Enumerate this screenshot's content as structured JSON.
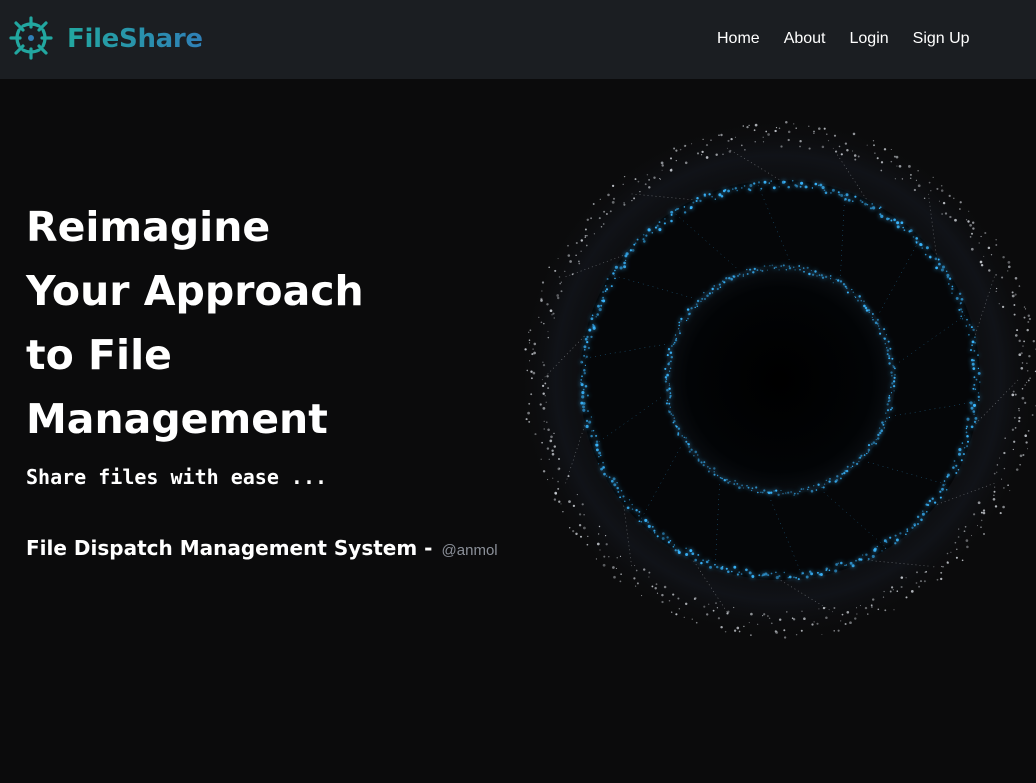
{
  "brand": {
    "name": "FileShare",
    "logo_icon": "network-star-icon",
    "color_from": "#22a7a0",
    "color_to": "#2f7fb6"
  },
  "nav": {
    "items": [
      {
        "label": "Home"
      },
      {
        "label": "About"
      },
      {
        "label": "Login"
      },
      {
        "label": "Sign Up"
      }
    ]
  },
  "hero": {
    "headline_lines": [
      "Reimagine",
      "Your Approach",
      "to File",
      "Management"
    ],
    "tagline": "Share files with ease ...",
    "system_title": "File Dispatch Management System -",
    "author": "@anmol",
    "visual_icon": "particle-orb-icon"
  },
  "colors": {
    "background": "#0b0b0c",
    "navbar": "#1b1e22",
    "text": "#ffffff",
    "muted": "#8b9099",
    "glow_blue": "#39b6ff",
    "particle_white": "#d9dde3"
  }
}
